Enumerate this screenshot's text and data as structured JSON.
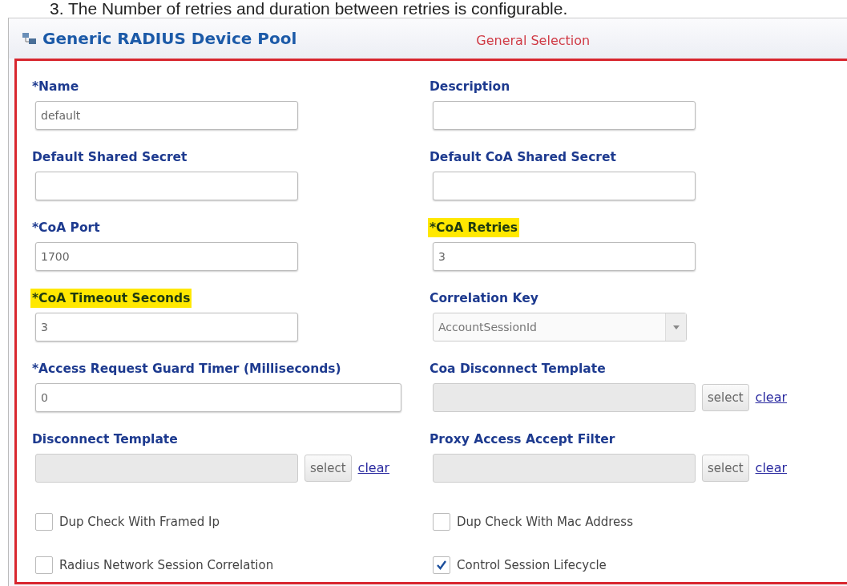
{
  "caption": "3. The Number of retries and duration between retries is configurable.",
  "panel": {
    "title": "Generic RADIUS Device Pool",
    "section": "General Selection"
  },
  "fields": [
    {
      "kind": "text",
      "label": "*Name",
      "value": "default",
      "highlighted": false
    },
    {
      "kind": "text",
      "label": "Description",
      "highlighted": false
    },
    {
      "kind": "text",
      "label": "Default Shared Secret",
      "highlighted": false
    },
    {
      "kind": "text",
      "label": "Default CoA Shared Secret",
      "highlighted": false
    },
    {
      "kind": "text",
      "label": "*CoA Port",
      "value": "1700",
      "highlighted": false
    },
    {
      "kind": "text",
      "label": "*CoA Retries",
      "value": "3",
      "highlighted": true
    },
    {
      "kind": "text",
      "label": "*CoA Timeout Seconds",
      "value": "3",
      "highlighted": true
    },
    {
      "kind": "select",
      "label": "Correlation Key",
      "value": "AccountSessionId",
      "highlighted": false
    },
    {
      "kind": "wide",
      "label": "*Access Request Guard Timer (Milliseconds)",
      "value": "0",
      "highlighted": false
    },
    {
      "kind": "picker",
      "label": "Coa Disconnect Template",
      "button": "select",
      "link": "clear",
      "highlighted": false
    },
    {
      "kind": "picker",
      "label": "Disconnect Template",
      "button": "select",
      "link": "clear",
      "highlighted": false
    },
    {
      "kind": "picker",
      "label": "Proxy Access Accept Filter",
      "button": "select",
      "link": "clear",
      "highlighted": false
    },
    {
      "kind": "checkbox",
      "label": "Dup Check With Framed Ip",
      "checked": false
    },
    {
      "kind": "checkbox",
      "label": "Dup Check With Mac Address",
      "checked": false
    },
    {
      "kind": "checkbox",
      "label": "Radius Network Session Correlation",
      "checked": false
    },
    {
      "kind": "checkbox",
      "label": "Control Session Lifecycle",
      "checked": true
    }
  ]
}
